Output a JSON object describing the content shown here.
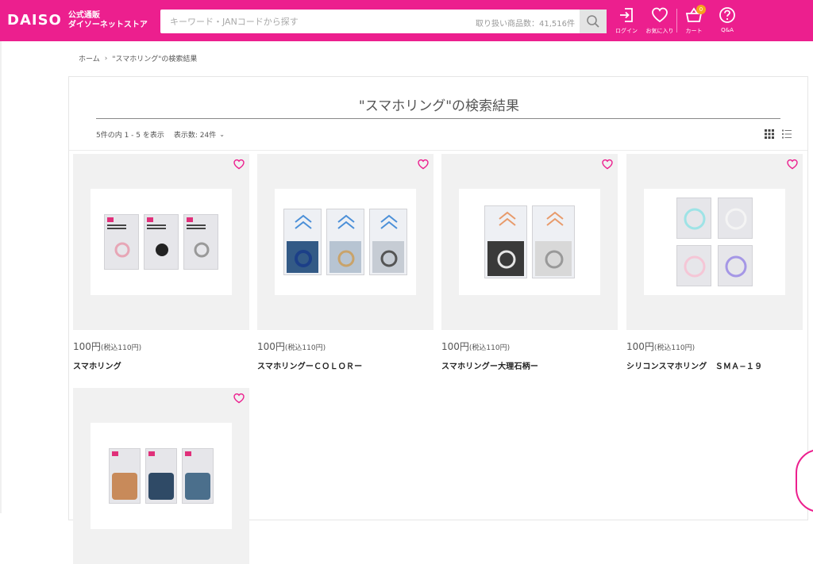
{
  "colors": {
    "brand": "#ec1f8e",
    "badge": "#f6a31c"
  },
  "header": {
    "logo": "DAISO",
    "logo_sub_line1": "公式通販",
    "logo_sub_line2": "ダイソーネットストア",
    "search": {
      "placeholder": "キーワード・JANコードから探す",
      "count_text": "取り扱い商品数：41,516件"
    },
    "icons": [
      {
        "name": "login-icon",
        "label": "ログイン"
      },
      {
        "name": "heart-icon",
        "label": "お気に入り"
      },
      {
        "name": "cart-icon",
        "label": "カート",
        "badge": "0"
      },
      {
        "name": "help-icon",
        "label": "Q&A"
      }
    ]
  },
  "breadcrumb": {
    "home": "ホーム",
    "separator": "›",
    "current": "\"スマホリング\"の検索結果"
  },
  "main": {
    "title": "\"スマホリング\"の検索結果",
    "result_info": "5件の内 1 - 5 を表示",
    "per_page": "表示数: 24件",
    "per_page_chevron": "⌄"
  },
  "products": [
    {
      "price": "100円",
      "tax": "(税込110円)",
      "name": "スマホリング"
    },
    {
      "price": "100円",
      "tax": "(税込110円)",
      "name": "スマホリングーＣＯＬＯＲー"
    },
    {
      "price": "100円",
      "tax": "(税込110円)",
      "name": "スマホリングー大理石柄ー"
    },
    {
      "price": "100円",
      "tax": "(税込110円)",
      "name": "シリコンスマホリング　ＳＭＡ−１９"
    },
    {
      "price": "",
      "tax": "",
      "name": ""
    }
  ]
}
